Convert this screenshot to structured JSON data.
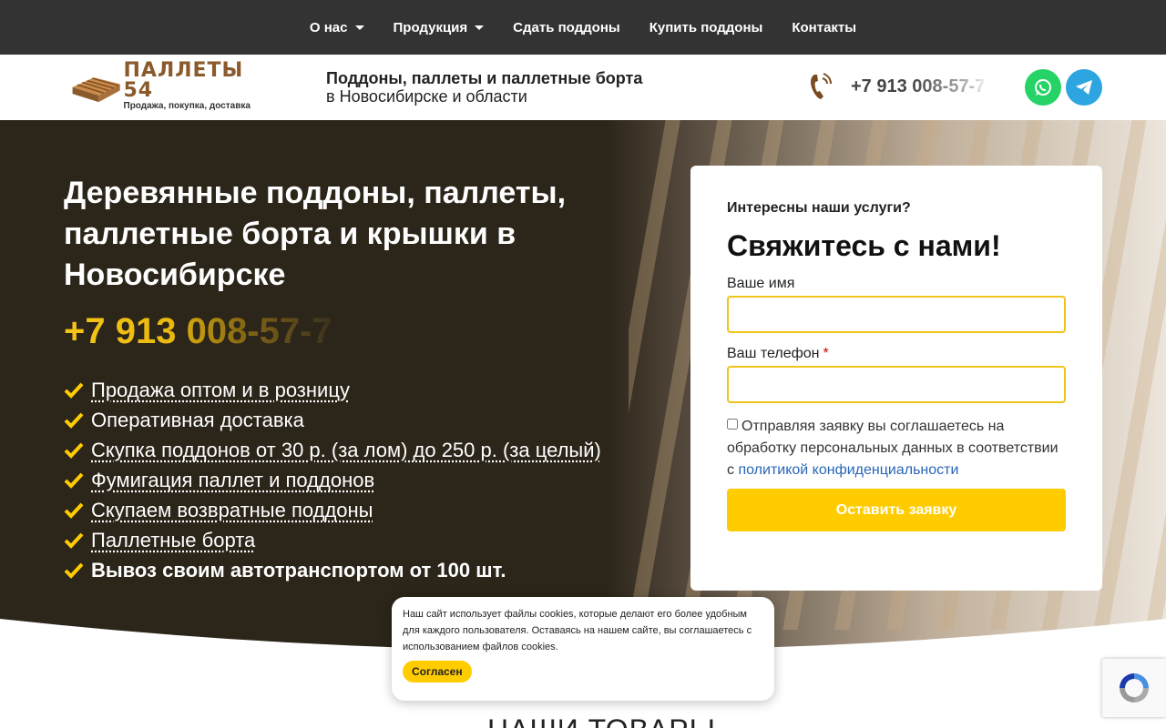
{
  "nav": {
    "items": [
      {
        "label": "О нас",
        "dropdown": true
      },
      {
        "label": "Продукция",
        "dropdown": true
      },
      {
        "label": "Сдать поддоны",
        "dropdown": false
      },
      {
        "label": "Купить поддоны",
        "dropdown": false
      },
      {
        "label": "Контакты",
        "dropdown": false
      }
    ]
  },
  "header": {
    "logo_title": "ПАЛЛЕТЫ 54",
    "logo_sub": "Продажа, покупка, доставка",
    "tagline_1": "Поддоны, паллеты и паллетные борта",
    "tagline_2": "в Новосибирске и области",
    "phone": "+7 913 008-57-7",
    "whatsapp_icon": "whatsapp-icon",
    "telegram_icon": "telegram-icon"
  },
  "hero": {
    "title": "Деревянные поддоны, паллеты, паллетные борта и крышки в Новосибирске",
    "phone": "+7 913 008-57-7",
    "features": [
      {
        "text": "Продажа оптом и в розницу",
        "style": "link"
      },
      {
        "text": "Оперативная доставка",
        "style": "plain"
      },
      {
        "text": "Скупка поддонов от 30 р. (за лом) до 250 р. (за целый)",
        "style": "link"
      },
      {
        "text": "Фумигация паллет и поддонов",
        "style": "link"
      },
      {
        "text": "Скупаем возвратные поддоны",
        "style": "link"
      },
      {
        "text": "Паллетные борта",
        "style": "link"
      },
      {
        "text": "Вывоз своим автотранспортом от 100 шт.",
        "style": "bold"
      }
    ]
  },
  "form": {
    "subtitle": "Интересны наши услуги?",
    "title": "Свяжитесь с нами!",
    "name_label": "Ваше имя",
    "phone_label": "Ваш телефон",
    "required_mark": "*",
    "name_value": "",
    "phone_value": "",
    "consent_text": "Отправляя заявку вы соглашаетесь на обработку персональных данных в соответствии с ",
    "consent_link": "политикой конфиденциальности",
    "consent_checked": false,
    "submit_label": "Оставить заявку"
  },
  "section": {
    "title": "НАШИ ТОВАРЫ"
  },
  "cookie": {
    "text": "Наш сайт использует файлы cookies, которые делают его более удобным для каждого пользователя. Оставаясь на нашем сайте, вы соглашаетесь с использованием файлов cookies.",
    "button": "Согласен"
  },
  "colors": {
    "accent": "#ffcc00",
    "dark": "#333333",
    "hero_bg": "#2c2519",
    "whatsapp": "#25d366",
    "telegram": "#2ca5e0",
    "link": "#2a66b8"
  }
}
